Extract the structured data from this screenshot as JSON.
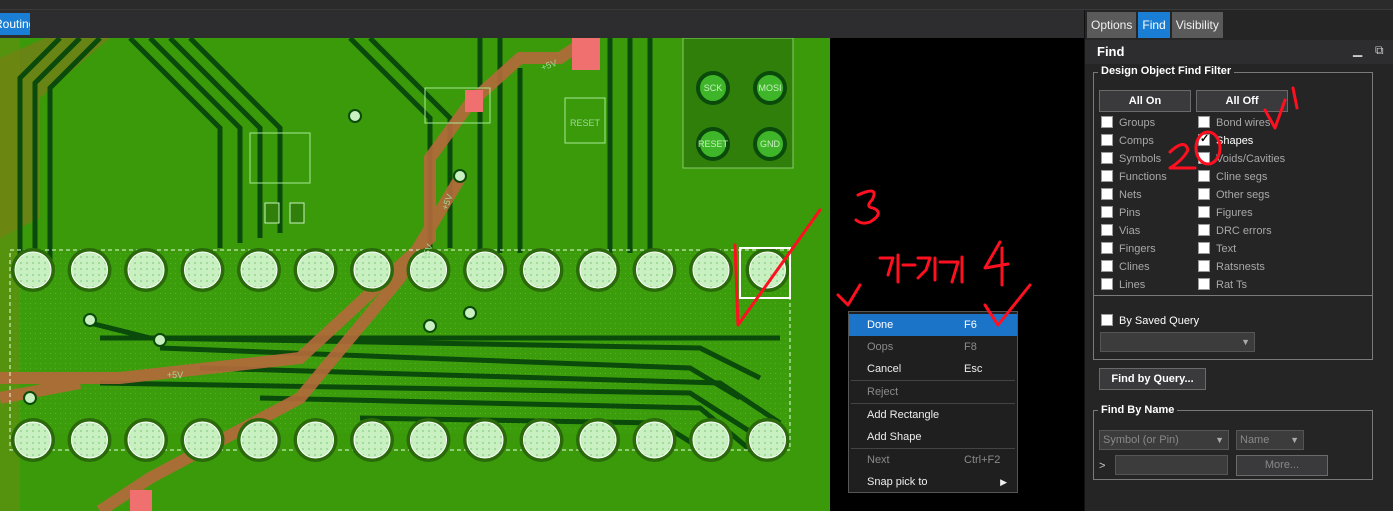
{
  "app": {
    "routing_tab": "Routing"
  },
  "canvas": {
    "silk_labels": [
      "SCK",
      "MOSI",
      "RESET",
      "GND",
      "RESET",
      "+5V",
      "+5V",
      "+5V",
      "+5V",
      "+5V"
    ],
    "net_label": "+5V"
  },
  "context_menu": {
    "items": [
      {
        "label": "Done",
        "shortcut": "F6",
        "state": "highlighted"
      },
      {
        "label": "Oops",
        "shortcut": "F8",
        "state": "disabled"
      },
      {
        "label": "Cancel",
        "shortcut": "Esc",
        "state": "normal"
      },
      {
        "label": "Reject",
        "shortcut": "",
        "state": "disabled"
      },
      {
        "label": "Add Rectangle",
        "shortcut": "",
        "state": "normal"
      },
      {
        "label": "Add Shape",
        "shortcut": "",
        "state": "normal"
      },
      {
        "label": "Next",
        "shortcut": "Ctrl+F2",
        "state": "disabled"
      },
      {
        "label": "Snap pick to",
        "shortcut": "",
        "state": "submenu"
      }
    ]
  },
  "panel": {
    "tabs": [
      "Options",
      "Find",
      "Visibility"
    ],
    "active_tab": "Find",
    "title": "Find",
    "filter": {
      "group_label": "Design Object Find Filter",
      "all_on": "All On",
      "all_off": "All Off",
      "left_items": [
        {
          "label": "Groups",
          "checked": false
        },
        {
          "label": "Comps",
          "checked": false
        },
        {
          "label": "Symbols",
          "checked": false
        },
        {
          "label": "Functions",
          "checked": false
        },
        {
          "label": "Nets",
          "checked": false
        },
        {
          "label": "Pins",
          "checked": false
        },
        {
          "label": "Vias",
          "checked": false
        },
        {
          "label": "Fingers",
          "checked": false
        },
        {
          "label": "Clines",
          "checked": false
        },
        {
          "label": "Lines",
          "checked": false
        }
      ],
      "right_items": [
        {
          "label": "Bond wires",
          "checked": false
        },
        {
          "label": "Shapes",
          "checked": true
        },
        {
          "label": "Voids/Cavities",
          "checked": false
        },
        {
          "label": "Cline segs",
          "checked": false
        },
        {
          "label": "Other segs",
          "checked": false
        },
        {
          "label": "Figures",
          "checked": false
        },
        {
          "label": "DRC errors",
          "checked": false
        },
        {
          "label": "Text",
          "checked": false
        },
        {
          "label": "Ratsnests",
          "checked": false
        },
        {
          "label": "Rat Ts",
          "checked": false
        }
      ],
      "saved_query_label": "By Saved Query",
      "saved_query_checked": false
    },
    "find_by_query": "Find by Query...",
    "find_by_name": {
      "group_label": "Find By Name",
      "type_combo": "Symbol (or Pin)",
      "field_combo": "Name",
      "prompt": ">",
      "more_button": "More..."
    }
  },
  "annotations": [
    "3",
    "4",
    "V1",
    "2",
    "우클릭"
  ],
  "colors": {
    "board": "#3a9a0a",
    "pad": "#c8f0c0",
    "trace_dark": "#0a4a0a",
    "trace_orange": "#b46a3a",
    "accent": "#1a7fd4",
    "ink": "#ff1020"
  }
}
